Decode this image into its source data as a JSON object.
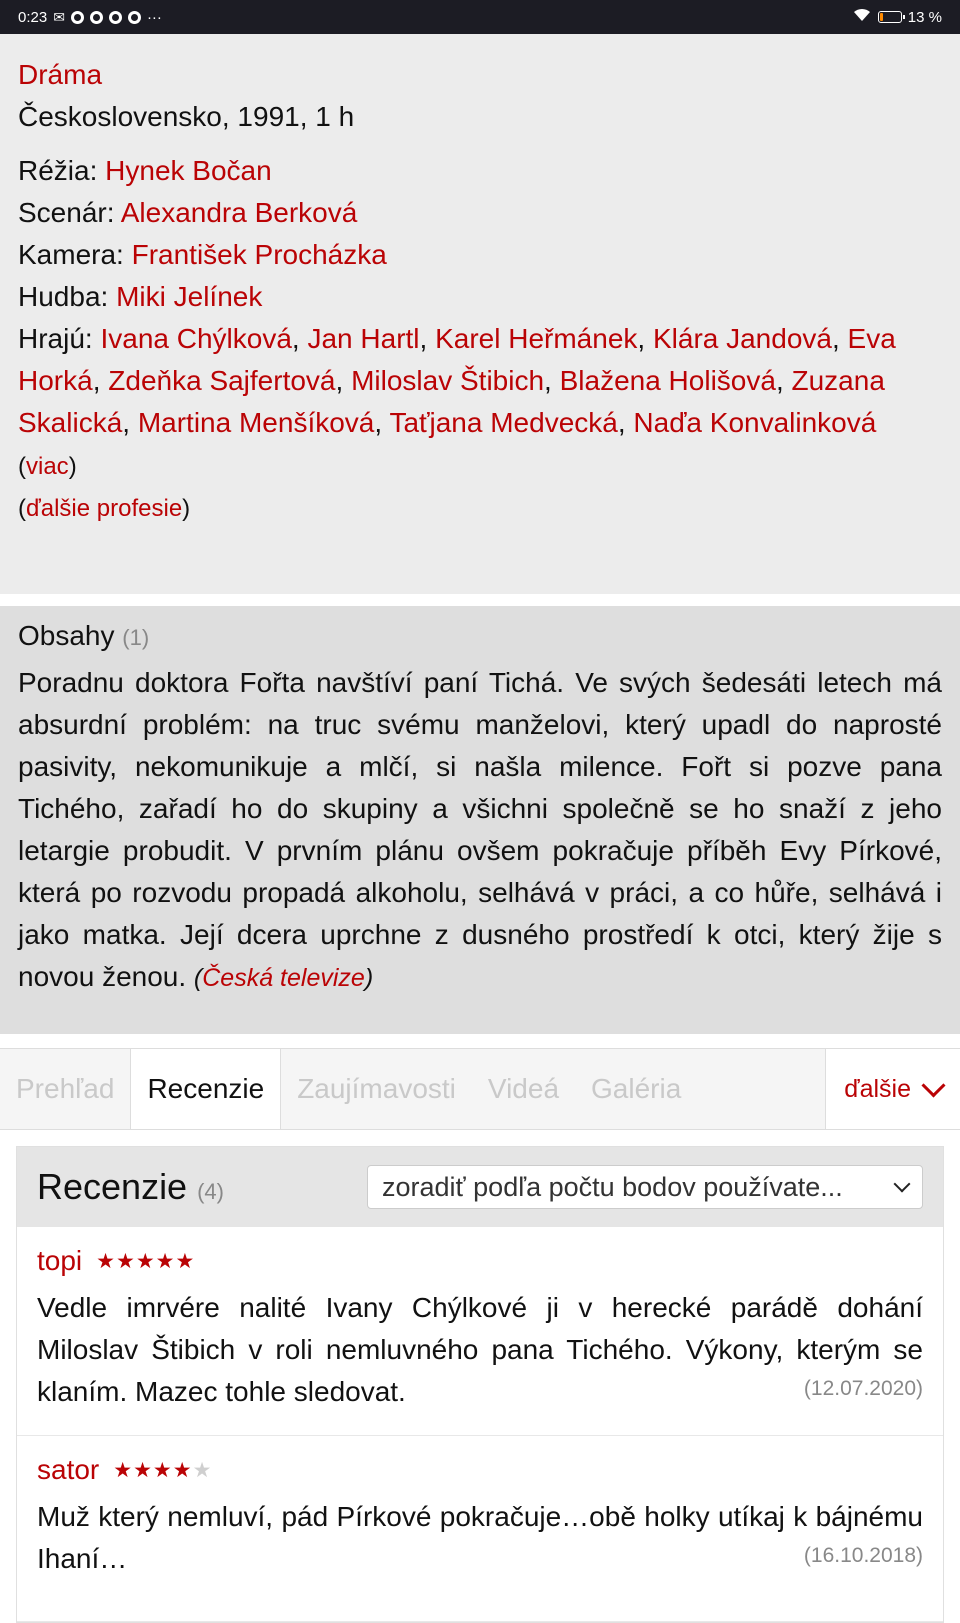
{
  "status_bar": {
    "time": "0:23",
    "battery": "13 %",
    "battery_level": 0.13
  },
  "film": {
    "genre": "Dráma",
    "origin": "Československo, 1991, 1 h",
    "directing_label": "Réžia:",
    "directing": [
      "Hynek Bočan"
    ],
    "screenplay_label": "Scenár:",
    "screenplay": [
      "Alexandra Berková"
    ],
    "camera_label": "Kamera:",
    "camera": [
      "František Procházka"
    ],
    "music_label": "Hudba:",
    "music": [
      "Miki Jelínek"
    ],
    "cast_label": "Hrajú:",
    "cast": [
      "Ivana Chýlková",
      "Jan Hartl",
      "Karel Heřmánek",
      "Klára Jandová",
      "Eva Horká",
      "Zdeňka Sajfertová",
      "Miloslav Štibich",
      "Blažena Holišová",
      "Zuzana Skalická",
      "Martina Menšíková",
      "Taťjana Medvecká",
      "Naďa Konvalinková"
    ],
    "more_label": "viac",
    "more_professions": "ďalšie profesie"
  },
  "plot": {
    "title": "Obsahy",
    "count": "(1)",
    "text": "Poradnu doktora Fořta navštíví paní Tichá. Ve svých šedesáti letech má absurdní problém: na truc svému manželovi, který upadl do naprosté pasivity, nekomunikuje a mlčí, si našla milence. Fořt si pozve pana Tichého, zařadí ho do skupiny a všichni společně se ho snaží z jeho letargie probudit. V prvním plánu ovšem pokračuje příběh Evy Pírkové, která po rozvodu propadá alkoholu, selhává v práci, a co hůře, selhává i jako matka. Její dcera uprchne z dusného prostředí k otci, který žije s novou ženou.",
    "source": "Česká televize"
  },
  "tabs": {
    "items": [
      "Prehľad",
      "Recenzie",
      "Zaujímavosti",
      "Videá",
      "Galéria"
    ],
    "active_index": 1,
    "more": "ďalšie"
  },
  "reviews": {
    "title": "Recenzie",
    "count": "(4)",
    "sort_value": "zoradiť podľa počtu bodov používate...",
    "items": [
      {
        "user": "topi",
        "rating": 5,
        "max_rating": 5,
        "text": "Vedle imrvére nalité Ivany Chýlkové ji v herecké parádě dohání Miloslav Štibich v roli nemluvného pana Tichého. Výkony, kterým se klaním. Mazec tohle sledovat.",
        "date": "(12.07.2020)"
      },
      {
        "user": "sator",
        "rating": 4,
        "max_rating": 5,
        "text": "Muž který nemluví, pád Pírkové pokračuje…obě holky utíkaj k bájnému Ihaní…",
        "date": "(16.10.2018)"
      }
    ]
  }
}
